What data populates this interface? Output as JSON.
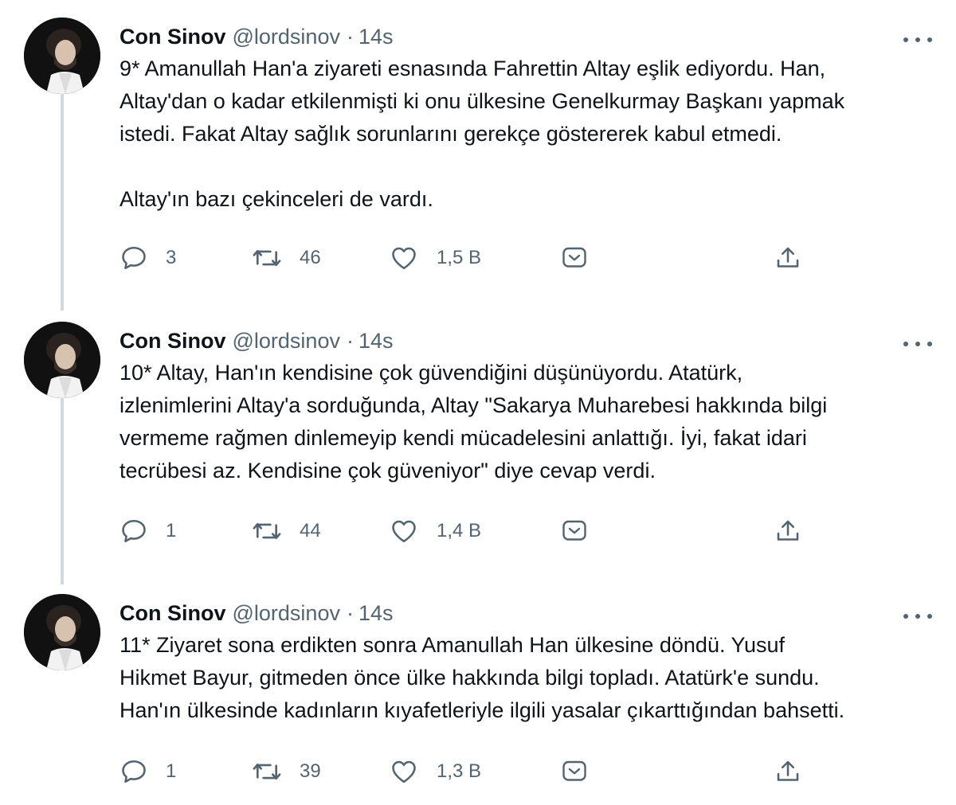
{
  "author": {
    "name": "Con Sinov",
    "handle": "@lordsinov",
    "separator": "·"
  },
  "tweets": [
    {
      "time": "14s",
      "text": [
        "9* Amanullah Han'a ziyareti esnasında Fahrettin Altay eşlik ediyordu. Han,",
        "Altay'dan o kadar etkilenmişti ki onu ülkesine Genelkurmay Başkanı yapmak",
        "istedi. Fakat Altay sağlık sorunlarını gerekçe göstererek kabul etmedi."
      ],
      "text2": "Altay'ın bazı çekinceleri de vardı.",
      "replies": "3",
      "retweets": "46",
      "likes": "1,5 B"
    },
    {
      "time": "14s",
      "text": [
        "10* Altay, Han'ın kendisine çok güvendiğini düşünüyordu. Atatürk,",
        "izlenimlerini Altay'a sorduğunda, Altay \"Sakarya Muharebesi hakkında bilgi",
        "vermeme rağmen dinlemeyip kendi mücadelesini anlattığı. İyi, fakat idari",
        "tecrübesi az. Kendisine çok güveniyor\" diye cevap verdi."
      ],
      "replies": "1",
      "retweets": "44",
      "likes": "1,4 B"
    },
    {
      "time": "14s",
      "text": [
        "11* Ziyaret sona erdikten sonra Amanullah Han ülkesine döndü. Yusuf",
        "Hikmet Bayur, gitmeden önce ülke hakkında bilgi topladı. Atatürk'e sundu.",
        "Han'ın ülkesinde kadınların kıyafetleriyle ilgili yasalar çıkarttığından bahsetti."
      ],
      "replies": "1",
      "retweets": "39",
      "likes": "1,3 B"
    }
  ],
  "icons": {
    "reply": "reply-icon",
    "retweet": "retweet-icon",
    "like": "like-icon",
    "tip": "tip-icon",
    "share": "share-icon",
    "more": "more-icon"
  },
  "colors": {
    "text": "#0f1419",
    "secondary": "#536471",
    "thread_line": "#cfd9de"
  }
}
